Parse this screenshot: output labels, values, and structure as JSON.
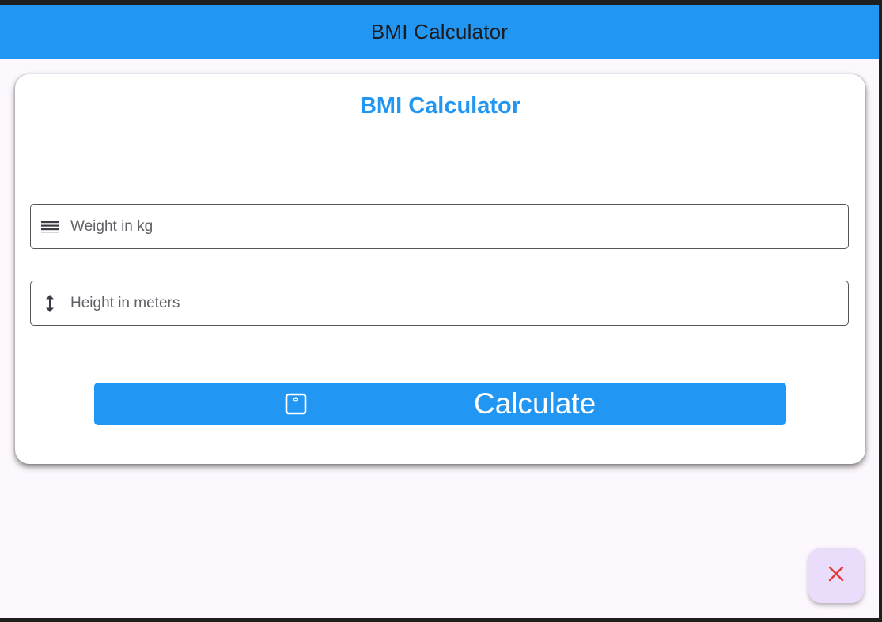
{
  "appbar": {
    "title": "BMI Calculator",
    "background": "#2196f3"
  },
  "card": {
    "title": "BMI Calculator",
    "title_color": "#2196f3"
  },
  "fields": {
    "weight": {
      "placeholder": "Weight in kg",
      "value": "",
      "icon": "weight-lines-icon"
    },
    "height": {
      "placeholder": "Height in meters",
      "value": "",
      "icon": "vertical-arrows-icon"
    }
  },
  "calculate_button": {
    "label": "Calculate",
    "icon": "scale-icon",
    "background": "#2196f3"
  },
  "fab": {
    "icon": "close-icon",
    "icon_color": "#e53935",
    "background": "#eadcfb"
  }
}
